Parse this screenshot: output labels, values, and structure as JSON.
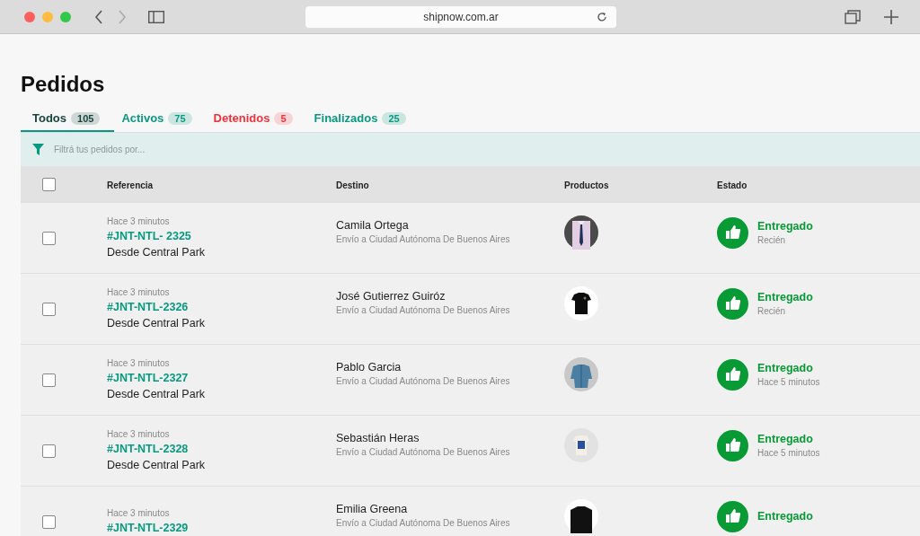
{
  "browser": {
    "url": "shipnow.com.ar"
  },
  "page": {
    "title": "Pedidos"
  },
  "tabs": [
    {
      "label": "Todos",
      "count": "105",
      "selected": true,
      "color": "#17463d"
    },
    {
      "label": "Activos",
      "count": "75",
      "selected": false,
      "color": "#079a80"
    },
    {
      "label": "Detenidos",
      "count": "5",
      "selected": false,
      "color": "#f2303a"
    },
    {
      "label": "Finalizados",
      "count": "25",
      "selected": false,
      "color": "#079a80"
    }
  ],
  "filter": {
    "placeholder": "Filtrá tus pedidos por..."
  },
  "table": {
    "select_all_checked": false,
    "columns": [
      "Referencia",
      "Destino",
      "Productos",
      "Estado"
    ],
    "rows": [
      {
        "checked": false,
        "time": "Hace 3 minutos",
        "reference": "#JNT-NTL- 2325",
        "origin": "Desde Central Park",
        "name": "Camila Ortega",
        "destination": "Envío a Ciudad Autónoma De Buenos Aires",
        "status": {
          "kind": "delivered",
          "label": "Entregado",
          "time": "Recién"
        }
      },
      {
        "checked": false,
        "time": "Hace 3 minutos",
        "reference": "#JNT-NTL-2326",
        "origin": "Desde Central Park",
        "name": "José Gutierrez Guiróz",
        "destination": "Envío a Ciudad Autónoma De Buenos Aires",
        "status": {
          "kind": "delivered",
          "label": "Entregado",
          "time": "Recién"
        }
      },
      {
        "checked": false,
        "time": "Hace 3 minutos",
        "reference": "#JNT-NTL-2327",
        "origin": "Desde Central Park",
        "name": "Pablo Garcia",
        "destination": "Envío a Ciudad Autónoma De Buenos Aires",
        "status": {
          "kind": "delivered",
          "label": "Entregado",
          "time": "Hace 5 minutos"
        }
      },
      {
        "checked": false,
        "time": "Hace 3 minutos",
        "reference": "#JNT-NTL-2328",
        "origin": "Desde Central Park",
        "name": "Sebastián Heras",
        "destination": "Envío a Ciudad Autónoma De Buenos Aires",
        "status": {
          "kind": "delivered",
          "label": "Entregado",
          "time": "Hace 5 minutos"
        }
      },
      {
        "checked": false,
        "time": "Hace 3 minutos",
        "reference": "#JNT-NTL-2329",
        "name": "Emilia Greena",
        "destination": "Envío a Ciudad Autónoma De Buenos Aires",
        "status": {
          "kind": "delivered",
          "label": "Entregado"
        }
      }
    ]
  }
}
